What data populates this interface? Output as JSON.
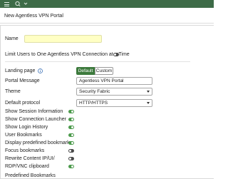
{
  "header": {
    "menu_icon": "hamburger-menu-icon",
    "search_icon": "search-icon",
    "dropdown_icon": "chevron-down-icon",
    "bar_color": "#3d6b47"
  },
  "page": {
    "title": "New Agentless VPN Portal"
  },
  "form": {
    "name_label": "Name",
    "name_value": "",
    "limit_label": "Limit Users to One Agentless VPN Connection at a Time",
    "limit_enabled": false,
    "landing_page_label": "Landing page",
    "landing_page_info_icon": "info-icon",
    "landing_page_options": [
      "Default",
      "Custom"
    ],
    "landing_page_selected": "Default",
    "portal_message_label": "Portal Message",
    "portal_message_value": "Agentless VPN Portal",
    "theme_label": "Theme",
    "theme_value": "Security Fabric",
    "protocol_label": "Default protocol",
    "protocol_value": "HTTP/HTTPS",
    "toggles": [
      {
        "label": "Show Session Information",
        "enabled": true
      },
      {
        "label": "Show Connection Launcher",
        "enabled": true
      },
      {
        "label": "Show Login History",
        "enabled": true
      },
      {
        "label": "User Bookmarks",
        "enabled": true
      },
      {
        "label": "Display predefined bookmarks",
        "enabled": true
      },
      {
        "label": "Focus bookmarks",
        "enabled": false
      },
      {
        "label": "Rewrite Content IP/UI/",
        "enabled": false
      },
      {
        "label": "RDP/VNC clipboard",
        "enabled": true
      }
    ],
    "predefined_bookmarks_label": "Predefined Bookmarks",
    "accent_color": "#3d7a3d"
  }
}
